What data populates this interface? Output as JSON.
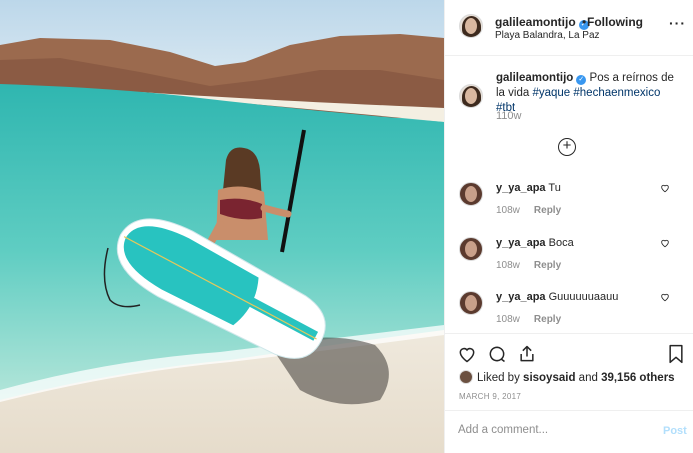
{
  "post": {
    "username": "galileamontijo",
    "verified_mark": "✓",
    "separator": "•",
    "follow_status": "Following",
    "location": "Playa Balandra, La Paz",
    "more_icon": "more-options-icon",
    "more_glyph": "···"
  },
  "caption": {
    "username": "galileamontijo",
    "text": "Pos a reírnos de la vida",
    "hashtags": [
      "#yaque",
      "#hechaenmexico",
      "#tbt"
    ],
    "time": "110w"
  },
  "load_more_glyph": "+",
  "comments": [
    {
      "username": "y_ya_apa",
      "text": "Tu",
      "time": "108w",
      "reply": "Reply"
    },
    {
      "username": "y_ya_apa",
      "text": "Boca",
      "time": "108w",
      "reply": "Reply"
    },
    {
      "username": "y_ya_apa",
      "text": "Guuuuuuaauu",
      "time": "108w",
      "reply": "Reply"
    }
  ],
  "likes": {
    "prefix": "Liked by",
    "user": "sisoysaid",
    "middle": "and",
    "count": "39,156 others"
  },
  "date": "MARCH 9, 2017",
  "add_comment": {
    "placeholder": "Add a comment...",
    "post_label": "Post"
  },
  "colors": {
    "verified": "#3897f0",
    "hashtag": "#003569",
    "post_disabled": "#b2dffc",
    "muted": "#8e8e8e"
  }
}
